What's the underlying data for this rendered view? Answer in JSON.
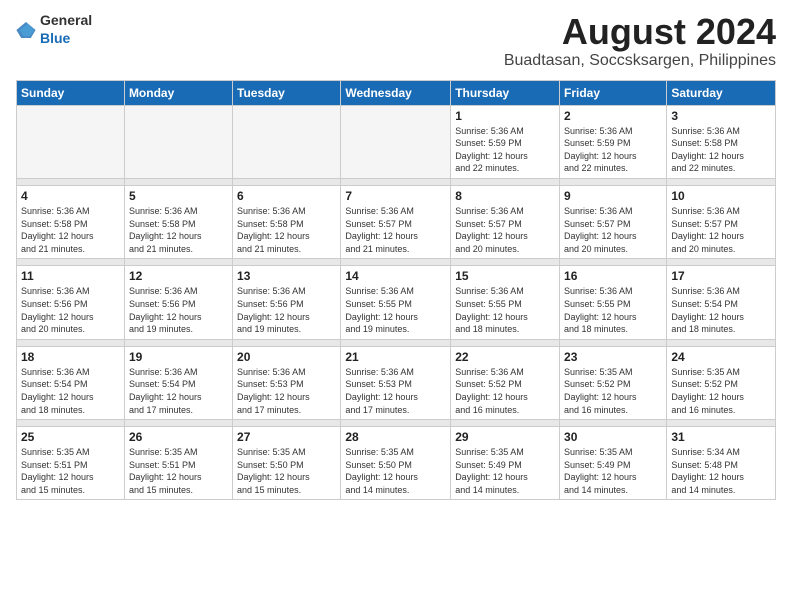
{
  "logo": {
    "general": "General",
    "blue": "Blue"
  },
  "title": {
    "month_year": "August 2024",
    "location": "Buadtasan, Soccsksargen, Philippines"
  },
  "weekdays": [
    "Sunday",
    "Monday",
    "Tuesday",
    "Wednesday",
    "Thursday",
    "Friday",
    "Saturday"
  ],
  "weeks": [
    {
      "days": [
        {
          "num": "",
          "info": "",
          "empty": true
        },
        {
          "num": "",
          "info": "",
          "empty": true
        },
        {
          "num": "",
          "info": "",
          "empty": true
        },
        {
          "num": "",
          "info": "",
          "empty": true
        },
        {
          "num": "1",
          "info": "Sunrise: 5:36 AM\nSunset: 5:59 PM\nDaylight: 12 hours\nand 22 minutes."
        },
        {
          "num": "2",
          "info": "Sunrise: 5:36 AM\nSunset: 5:59 PM\nDaylight: 12 hours\nand 22 minutes."
        },
        {
          "num": "3",
          "info": "Sunrise: 5:36 AM\nSunset: 5:58 PM\nDaylight: 12 hours\nand 22 minutes."
        }
      ]
    },
    {
      "days": [
        {
          "num": "4",
          "info": "Sunrise: 5:36 AM\nSunset: 5:58 PM\nDaylight: 12 hours\nand 21 minutes."
        },
        {
          "num": "5",
          "info": "Sunrise: 5:36 AM\nSunset: 5:58 PM\nDaylight: 12 hours\nand 21 minutes."
        },
        {
          "num": "6",
          "info": "Sunrise: 5:36 AM\nSunset: 5:58 PM\nDaylight: 12 hours\nand 21 minutes."
        },
        {
          "num": "7",
          "info": "Sunrise: 5:36 AM\nSunset: 5:57 PM\nDaylight: 12 hours\nand 21 minutes."
        },
        {
          "num": "8",
          "info": "Sunrise: 5:36 AM\nSunset: 5:57 PM\nDaylight: 12 hours\nand 20 minutes."
        },
        {
          "num": "9",
          "info": "Sunrise: 5:36 AM\nSunset: 5:57 PM\nDaylight: 12 hours\nand 20 minutes."
        },
        {
          "num": "10",
          "info": "Sunrise: 5:36 AM\nSunset: 5:57 PM\nDaylight: 12 hours\nand 20 minutes."
        }
      ]
    },
    {
      "days": [
        {
          "num": "11",
          "info": "Sunrise: 5:36 AM\nSunset: 5:56 PM\nDaylight: 12 hours\nand 20 minutes."
        },
        {
          "num": "12",
          "info": "Sunrise: 5:36 AM\nSunset: 5:56 PM\nDaylight: 12 hours\nand 19 minutes."
        },
        {
          "num": "13",
          "info": "Sunrise: 5:36 AM\nSunset: 5:56 PM\nDaylight: 12 hours\nand 19 minutes."
        },
        {
          "num": "14",
          "info": "Sunrise: 5:36 AM\nSunset: 5:55 PM\nDaylight: 12 hours\nand 19 minutes."
        },
        {
          "num": "15",
          "info": "Sunrise: 5:36 AM\nSunset: 5:55 PM\nDaylight: 12 hours\nand 18 minutes."
        },
        {
          "num": "16",
          "info": "Sunrise: 5:36 AM\nSunset: 5:55 PM\nDaylight: 12 hours\nand 18 minutes."
        },
        {
          "num": "17",
          "info": "Sunrise: 5:36 AM\nSunset: 5:54 PM\nDaylight: 12 hours\nand 18 minutes."
        }
      ]
    },
    {
      "days": [
        {
          "num": "18",
          "info": "Sunrise: 5:36 AM\nSunset: 5:54 PM\nDaylight: 12 hours\nand 18 minutes."
        },
        {
          "num": "19",
          "info": "Sunrise: 5:36 AM\nSunset: 5:54 PM\nDaylight: 12 hours\nand 17 minutes."
        },
        {
          "num": "20",
          "info": "Sunrise: 5:36 AM\nSunset: 5:53 PM\nDaylight: 12 hours\nand 17 minutes."
        },
        {
          "num": "21",
          "info": "Sunrise: 5:36 AM\nSunset: 5:53 PM\nDaylight: 12 hours\nand 17 minutes."
        },
        {
          "num": "22",
          "info": "Sunrise: 5:36 AM\nSunset: 5:52 PM\nDaylight: 12 hours\nand 16 minutes."
        },
        {
          "num": "23",
          "info": "Sunrise: 5:35 AM\nSunset: 5:52 PM\nDaylight: 12 hours\nand 16 minutes."
        },
        {
          "num": "24",
          "info": "Sunrise: 5:35 AM\nSunset: 5:52 PM\nDaylight: 12 hours\nand 16 minutes."
        }
      ]
    },
    {
      "days": [
        {
          "num": "25",
          "info": "Sunrise: 5:35 AM\nSunset: 5:51 PM\nDaylight: 12 hours\nand 15 minutes."
        },
        {
          "num": "26",
          "info": "Sunrise: 5:35 AM\nSunset: 5:51 PM\nDaylight: 12 hours\nand 15 minutes."
        },
        {
          "num": "27",
          "info": "Sunrise: 5:35 AM\nSunset: 5:50 PM\nDaylight: 12 hours\nand 15 minutes."
        },
        {
          "num": "28",
          "info": "Sunrise: 5:35 AM\nSunset: 5:50 PM\nDaylight: 12 hours\nand 14 minutes."
        },
        {
          "num": "29",
          "info": "Sunrise: 5:35 AM\nSunset: 5:49 PM\nDaylight: 12 hours\nand 14 minutes."
        },
        {
          "num": "30",
          "info": "Sunrise: 5:35 AM\nSunset: 5:49 PM\nDaylight: 12 hours\nand 14 minutes."
        },
        {
          "num": "31",
          "info": "Sunrise: 5:34 AM\nSunset: 5:48 PM\nDaylight: 12 hours\nand 14 minutes."
        }
      ]
    }
  ]
}
